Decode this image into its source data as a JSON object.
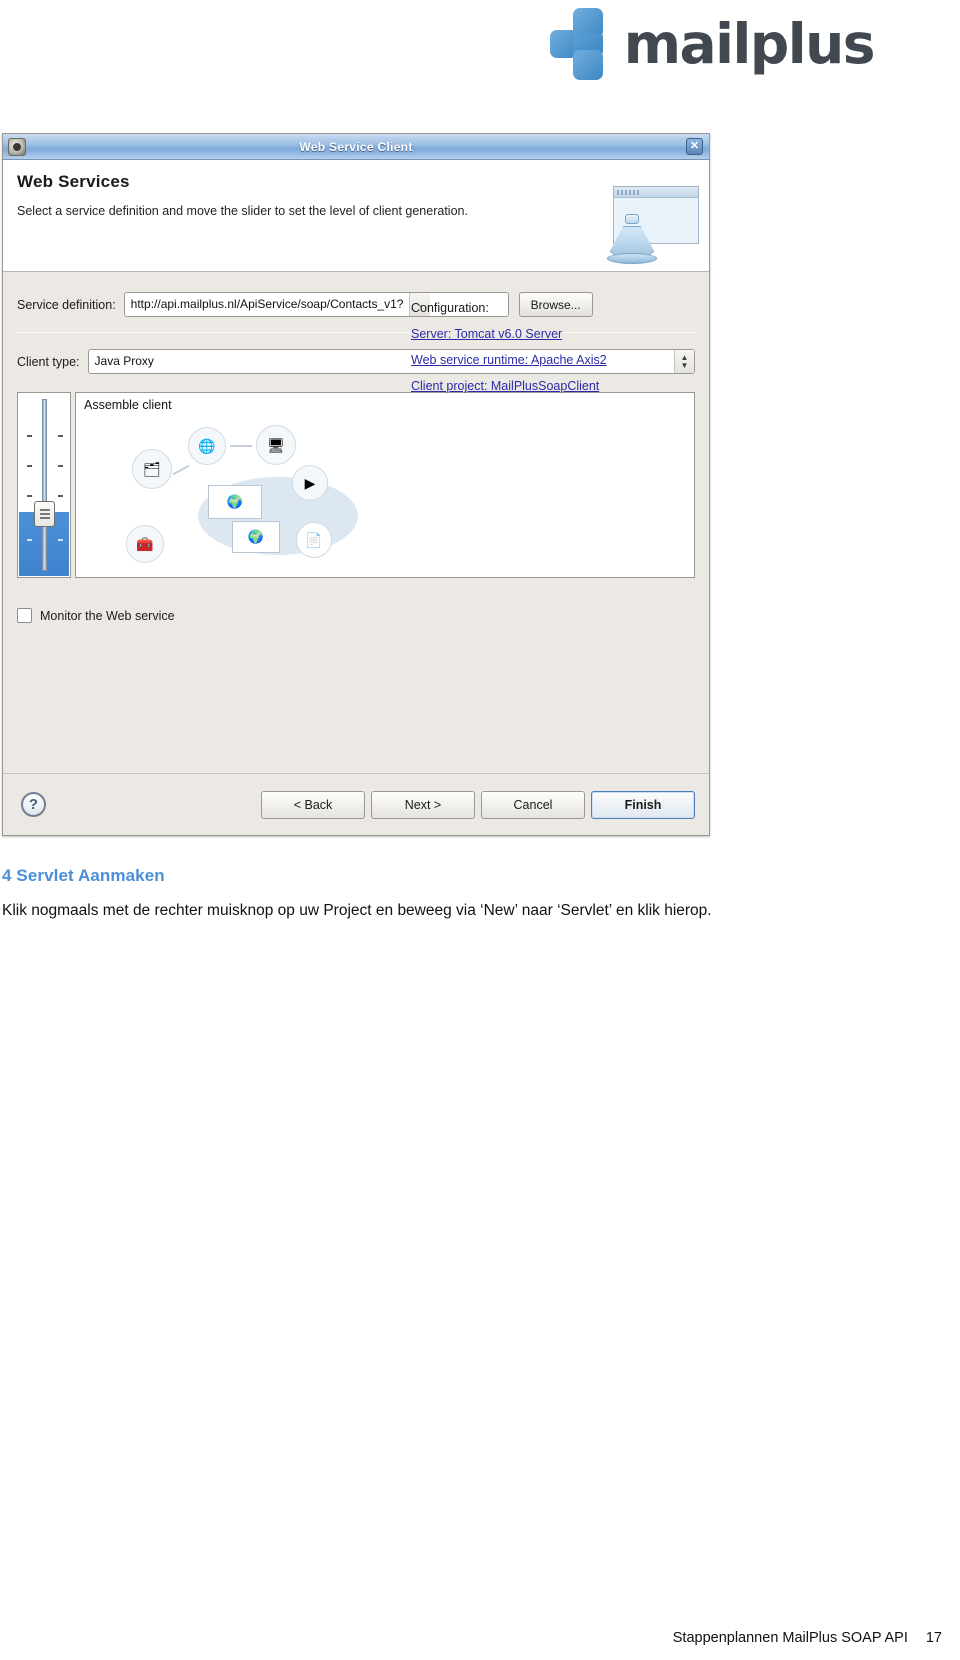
{
  "logo": {
    "text": "mailplus",
    "accent_color": "#3d87c4"
  },
  "dialog": {
    "titlebar": {
      "title": "Web Service Client",
      "close_label": "✕"
    },
    "header": {
      "heading": "Web Services",
      "description": "Select a service definition and move the slider to set the level of client generation."
    },
    "service_definition": {
      "label": "Service definition:",
      "value": "http://api.mailplus.nl/ApiService/soap/Contacts_v1?",
      "dropdown_arrow": "⌄",
      "browse_label": "Browse..."
    },
    "client_type": {
      "label": "Client type:",
      "value": "Java Proxy",
      "spinner_up": "▲",
      "spinner_down": "▼"
    },
    "assemble_panel": {
      "caption": "Assemble client"
    },
    "configuration": {
      "title": "Configuration:",
      "links": [
        "Server: Tomcat v6.0 Server",
        "Web service runtime: Apache Axis2",
        "Client project: MailPlusSoapClient"
      ]
    },
    "monitor": {
      "label": "Monitor the Web service",
      "checked": false
    },
    "footer": {
      "help_label": "?",
      "buttons": [
        {
          "label": "< Back",
          "default": false
        },
        {
          "label": "Next >",
          "default": false
        },
        {
          "label": "Cancel",
          "default": false
        },
        {
          "label": "Finish",
          "default": true
        }
      ]
    }
  },
  "document": {
    "heading": "4 Servlet Aanmaken",
    "paragraph": "Klik nogmaals met de rechter muisknop op uw Project en beweeg via ‘New’ naar ‘Servlet’ en klik hierop.",
    "footer_text": "Stappenplannen MailPlus SOAP API",
    "page_number": "17"
  }
}
